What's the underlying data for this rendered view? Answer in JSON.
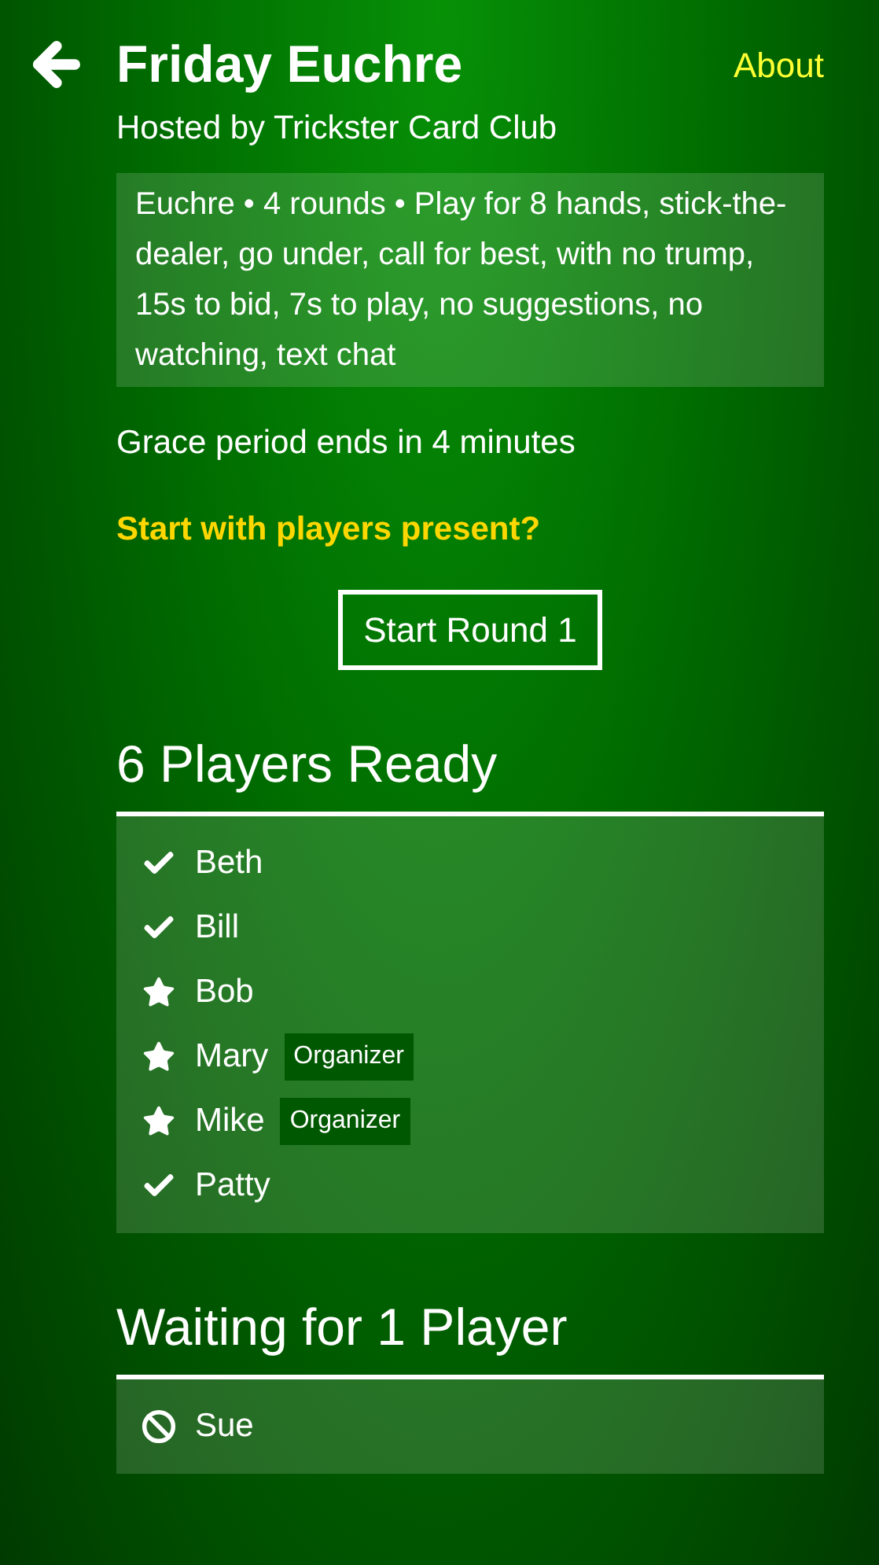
{
  "header": {
    "title": "Friday Euchre",
    "about_link": "About",
    "host": "Hosted by Trickster Card Club"
  },
  "description": "Euchre • 4 rounds • Play for 8 hands, stick-the-dealer, go under, call for best, with no trump, 15s to bid, 7s to play, no suggestions, no watching, text chat",
  "grace_notice": "Grace period ends in 4 minutes",
  "start_prompt": "Start with players present?",
  "start_button": "Start Round 1",
  "sections": [
    {
      "heading": "6 Players Ready",
      "players": [
        {
          "name": "Beth",
          "kind": "ready"
        },
        {
          "name": "Bill",
          "kind": "ready"
        },
        {
          "name": "Bob",
          "kind": "star"
        },
        {
          "name": "Mary",
          "kind": "star",
          "badge": "Organizer"
        },
        {
          "name": "Mike",
          "kind": "star",
          "badge": "Organizer"
        },
        {
          "name": "Patty",
          "kind": "ready"
        }
      ]
    },
    {
      "heading": "Waiting for 1 Player",
      "players": [
        {
          "name": "Sue",
          "kind": "absent"
        }
      ]
    }
  ]
}
